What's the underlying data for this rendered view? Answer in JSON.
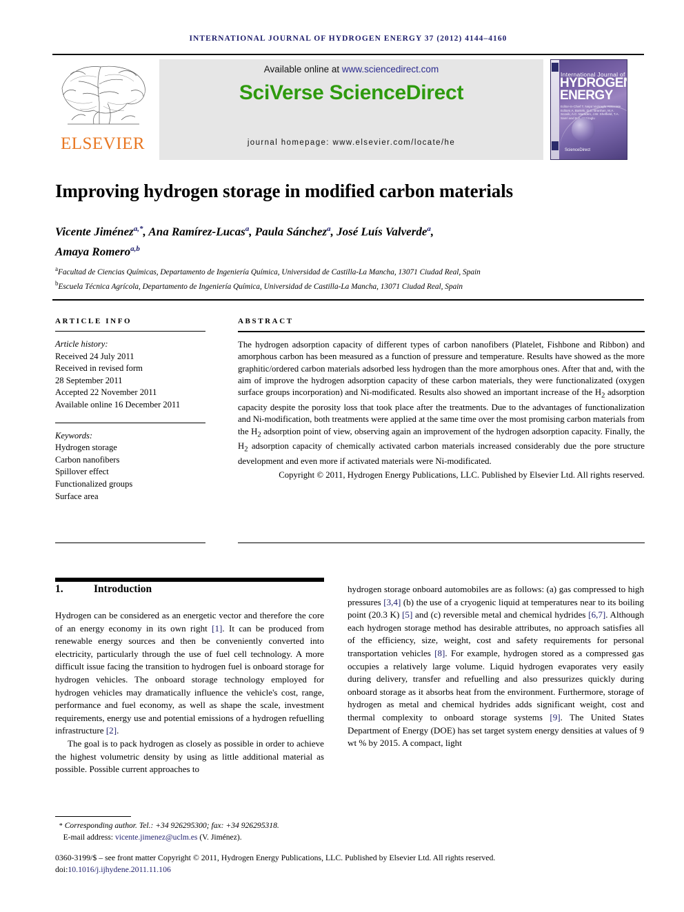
{
  "colors": {
    "link_blue": "#2b2b8f",
    "ref_blue": "#1d1d6b",
    "sciverse_green": "#2e9a0e",
    "elsevier_orange": "#e87722"
  },
  "running_head": "International Journal of Hydrogen Energy 37 (2012) 4144–4160",
  "masthead": {
    "elsevier_wordmark": "ELSEVIER",
    "available_prefix": "Available online at ",
    "available_url": "www.sciencedirect.com",
    "sciverse": "SciVerse ScienceDirect",
    "journal_homepage": "journal homepage: www.elsevier.com/locate/he",
    "cover": {
      "line1": "International Journal of",
      "line2": "HYDROGEN",
      "line3": "ENERGY",
      "editors": "Editor-in-Chief  T. Nejat Veziroglu\nAssociate Editors  A. Bartels, D.C. Branhan, M.A. Scovik, A.C. Marsden, J.W. Sheffield, T.A. Sanri and E.A. Veziroglu",
      "sciencedirect_mark": "ScienceDirect"
    }
  },
  "article": {
    "title": "Improving hydrogen storage in modified carbon materials",
    "authors": [
      {
        "name": "Vicente Jiménez",
        "sup": "a,*"
      },
      {
        "name": "Ana Ramírez-Lucas",
        "sup": "a"
      },
      {
        "name": "Paula Sánchez",
        "sup": "a"
      },
      {
        "name": "José Luís Valverde",
        "sup": "a"
      },
      {
        "name": "Amaya Romero",
        "sup": "a,b"
      }
    ],
    "affiliations": [
      {
        "mark": "a",
        "text": "Facultad de Ciencias Químicas, Departamento de Ingeniería Química, Universidad de Castilla-La Mancha, 13071 Ciudad Real, Spain"
      },
      {
        "mark": "b",
        "text": "Escuela Técnica Agrícola, Departamento de Ingeniería Química, Universidad de Castilla-La Mancha, 13071 Ciudad Real, Spain"
      }
    ]
  },
  "article_info": {
    "heading": "ARTICLE INFO",
    "history_label": "Article history:",
    "history": [
      "Received 24 July 2011",
      "Received in revised form",
      "28 September 2011",
      "Accepted 22 November 2011",
      "Available online 16 December 2011"
    ],
    "keywords_label": "Keywords:",
    "keywords": [
      "Hydrogen storage",
      "Carbon nanofibers",
      "Spillover effect",
      "Functionalized groups",
      "Surface area"
    ]
  },
  "abstract": {
    "heading": "ABSTRACT",
    "body_part1": "The hydrogen adsorption capacity of different types of carbon nanofibers (Platelet, Fishbone and Ribbon) and amorphous carbon has been measured as a function of pressure and temperature. Results have showed as the more graphitic/ordered carbon materials adsorbed less hydrogen than the more amorphous ones. After that and, with the aim of improve the hydrogen adsorption capacity of these carbon materials, they were functionalizated (oxygen surface groups incorporation) and Ni-modificated. Results also showed an important increase of the H",
    "sub1": "2",
    "body_part2": " adsorption capacity despite the porosity loss that took place after the treatments. Due to the advantages of functionalization and Ni-modification, both treatments were applied at the same time over the most promising carbon materials from the H",
    "sub2": "2",
    "body_part3": " adsorption point of view, observing again an improvement of the hydrogen adsorption capacity. Finally, the H",
    "sub3": "2",
    "body_part4": " adsorption capacity of chemically activated carbon materials increased considerably due the pore structure development and even more if activated materials were Ni-modificated.",
    "copyright": "Copyright © 2011, Hydrogen Energy Publications, LLC. Published by Elsevier Ltd. All rights reserved."
  },
  "section": {
    "number": "1.",
    "title": "Introduction"
  },
  "intro_left": {
    "p1_a": "Hydrogen can be considered as an energetic vector and therefore the core of an energy economy in its own right ",
    "p1_ref1": "[1]",
    "p1_b": ". It can be produced from renewable energy sources and then be conveniently converted into electricity, particularly through the use of fuel cell technology. A more difficult issue facing the transition to hydrogen fuel is onboard storage for hydrogen vehicles. The onboard storage technology employed for hydrogen vehicles may dramatically influence the vehicle's cost, range, performance and fuel economy, as well as shape the scale, investment requirements, energy use and potential emissions of a hydrogen refuelling infrastructure ",
    "p1_ref2": "[2]",
    "p1_c": ".",
    "p2": "The goal is to pack hydrogen as closely as possible in order to achieve the highest volumetric density by using as little additional material as possible. Possible current approaches to"
  },
  "intro_right": {
    "a": "hydrogen storage onboard automobiles are as follows: (a) gas compressed to high pressures ",
    "ref34": "[3,4]",
    "b": " (b) the use of a cryogenic liquid at temperatures near to its boiling point (20.3 K) ",
    "ref5": "[5]",
    "c": " and (c) reversible metal and chemical hydrides ",
    "ref67": "[6,7]",
    "d": ". Although each hydrogen storage method has desirable attributes, no approach satisfies all of the efficiency, size, weight, cost and safety requirements for personal transportation vehicles ",
    "ref8": "[8]",
    "e": ". For example, hydrogen stored as a compressed gas occupies a relatively large volume. Liquid hydrogen evaporates very easily during delivery, transfer and refuelling and also pressurizes quickly during onboard storage as it absorbs heat from the environment. Furthermore, storage of hydrogen as metal and chemical hydrides adds significant weight, cost and thermal complexity to onboard storage systems ",
    "ref9": "[9]",
    "f": ". The United States Department of Energy (DOE) has set target system energy densities at values of 9 wt % by 2015. A compact, light"
  },
  "footnote": {
    "star": "*",
    "corresponding": "Corresponding author. Tel.: +34 926295300; fax: +34 926295318.",
    "email_label": "E-mail address: ",
    "email": "vicente.jimenez@uclm.es",
    "email_suffix": " (V. Jiménez)."
  },
  "imprint": {
    "line1": "0360-3199/$ – see front matter Copyright © 2011, Hydrogen Energy Publications, LLC. Published by Elsevier Ltd. All rights reserved.",
    "doi_label": "doi:",
    "doi": "10.1016/j.ijhydene.2011.11.106"
  }
}
